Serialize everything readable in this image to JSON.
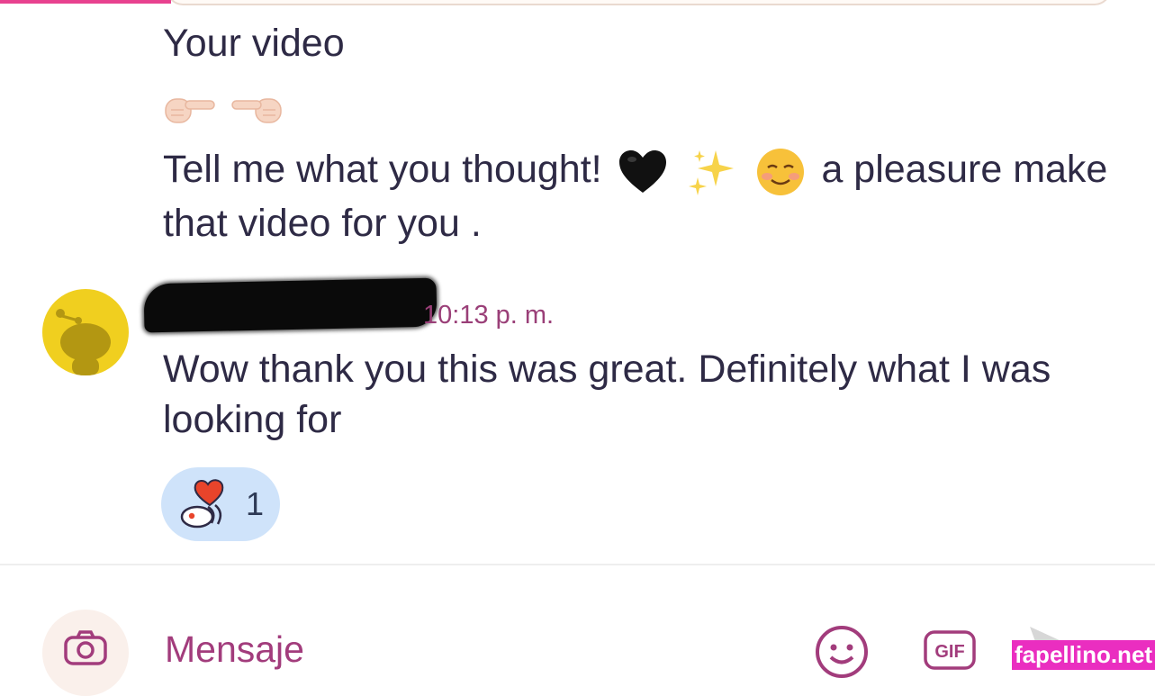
{
  "previous_message": {
    "line1": "Your video",
    "line2_text": "Tell me what you thought!",
    "line2_emojis": [
      "black-heart-emoji",
      "sparkles-emoji",
      "smiling-face-emoji"
    ],
    "line2_tail": "a pleasure make that video for you ."
  },
  "reply": {
    "timestamp": "10:13 p. m.",
    "text": "Wow thank you this was great. Definitely what I was looking for"
  },
  "reaction": {
    "icon": "snoo-heart-icon",
    "count": "1"
  },
  "composer": {
    "placeholder": "Mensaje",
    "camera_icon": "camera-icon",
    "emoji_icon": "emoji-icon",
    "gif_label": "GIF",
    "send_icon": "send-icon"
  },
  "watermark": "fapellino.net",
  "colors": {
    "accent": "#e8418f",
    "timestamp": "#9a3f78",
    "composer": "#a23c7c",
    "reaction_bg": "#cfe3fa",
    "avatar_bg": "#f0cf1f"
  }
}
